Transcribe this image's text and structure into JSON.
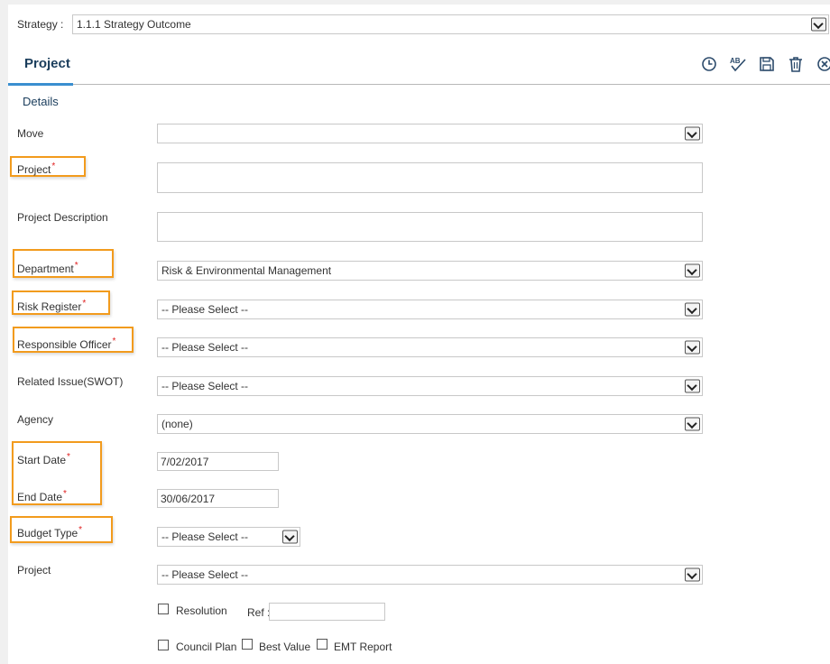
{
  "strategy": {
    "label": "Strategy :",
    "value": "1.1.1 Strategy Outcome"
  },
  "header": {
    "title": "Project"
  },
  "toolbar": [
    {
      "name": "history-icon",
      "icon": "clock"
    },
    {
      "name": "spellcheck-icon",
      "icon": "abc-check",
      "text": "AB"
    },
    {
      "name": "save-icon",
      "icon": "floppy-disk"
    },
    {
      "name": "delete-icon",
      "icon": "trash"
    },
    {
      "name": "close-icon",
      "icon": "circle-x"
    }
  ],
  "section": {
    "title": "Details"
  },
  "form": {
    "move": {
      "label": "Move",
      "value": ""
    },
    "project": {
      "label": "Project",
      "required": "*",
      "value": ""
    },
    "description": {
      "label": "Project Description",
      "value": ""
    },
    "department": {
      "label": "Department",
      "required": "*",
      "value": "Risk & Environmental Management"
    },
    "risk_register": {
      "label": "Risk Register",
      "required": "*",
      "value": "-- Please Select --"
    },
    "responsible_officer": {
      "label": "Responsible Officer",
      "required": "*",
      "value": "-- Please Select --"
    },
    "related_issue": {
      "label": "Related Issue(SWOT)",
      "value": "-- Please Select --"
    },
    "agency": {
      "label": "Agency",
      "value": "(none)"
    },
    "start_date": {
      "label": "Start Date",
      "required": "*",
      "value": "7/02/2017"
    },
    "end_date": {
      "label": "End Date",
      "required": "*",
      "value": "30/06/2017"
    },
    "budget_type": {
      "label": "Budget Type",
      "required": "*",
      "value": "-- Please Select --"
    },
    "project2": {
      "label": "Project",
      "value": "-- Please Select --"
    },
    "resolution": {
      "label": "Resolution",
      "checked": false
    },
    "ref": {
      "label": "Ref :",
      "value": ""
    },
    "council_plan": {
      "label": "Council Plan",
      "checked": false
    },
    "best_value": {
      "label": "Best Value",
      "checked": false
    },
    "emt_report": {
      "label": "EMT Report",
      "checked": false
    }
  },
  "colors": {
    "accent": "#1a3d5c",
    "tab_underline": "#3a8fd0",
    "highlight": "#f29b1d",
    "required": "#e02020"
  }
}
